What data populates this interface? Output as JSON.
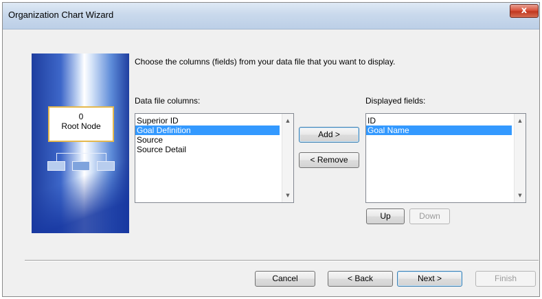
{
  "window": {
    "title": "Organization Chart Wizard"
  },
  "image": {
    "node_number": "0",
    "node_label": "Root Node"
  },
  "instructions": "Choose the columns (fields) from your data file that you want to display.",
  "data_file_columns": {
    "label": "Data file columns:",
    "items": [
      "Superior ID",
      "Goal Definition",
      "Source",
      "Source Detail"
    ],
    "selected": "Goal Definition"
  },
  "displayed_fields": {
    "label": "Displayed fields:",
    "items": [
      "ID",
      "Goal Name"
    ],
    "selected": "Goal Name"
  },
  "buttons": {
    "add": "Add >",
    "remove": "< Remove",
    "up": "Up",
    "down": "Down",
    "cancel": "Cancel",
    "back": "< Back",
    "next": "Next >",
    "finish": "Finish",
    "close": "x"
  },
  "colors": {
    "selection": "#3399ff",
    "title_bar": "#c9d9ec",
    "close": "#c7442c"
  }
}
